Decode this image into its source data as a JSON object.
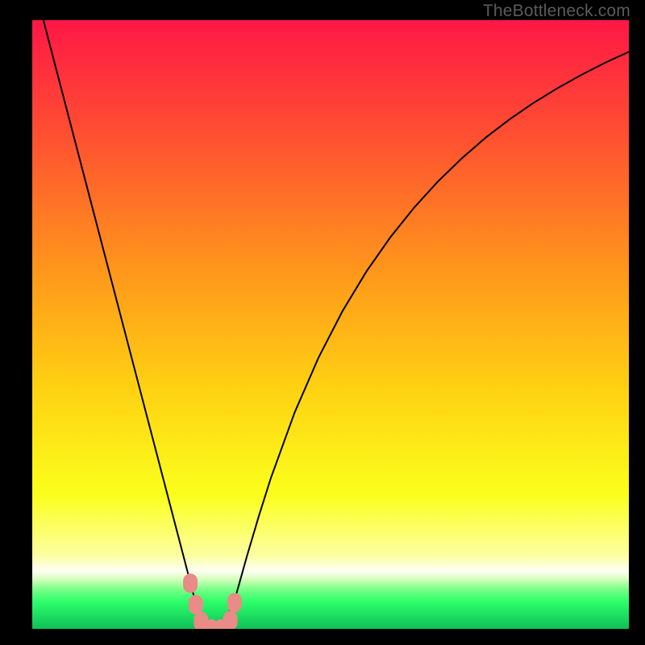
{
  "watermark": "TheBottleneck.com",
  "colors": {
    "bg_black": "#000000",
    "curve": "#000000",
    "marker": "#e98b86",
    "gradient_stops": [
      {
        "offset": 0.0,
        "color": "#ff1746"
      },
      {
        "offset": 0.2,
        "color": "#ff5330"
      },
      {
        "offset": 0.4,
        "color": "#ff931c"
      },
      {
        "offset": 0.6,
        "color": "#ffd012"
      },
      {
        "offset": 0.78,
        "color": "#fbff1c"
      },
      {
        "offset": 0.88,
        "color": "#fcffa2"
      },
      {
        "offset": 0.905,
        "color": "#fdfff5"
      },
      {
        "offset": 0.918,
        "color": "#d7ffbe"
      },
      {
        "offset": 0.935,
        "color": "#79ff88"
      },
      {
        "offset": 0.955,
        "color": "#2dff6a"
      },
      {
        "offset": 1.0,
        "color": "#0fbf58"
      }
    ]
  },
  "chart_data": {
    "type": "line",
    "title": "",
    "xlabel": "",
    "ylabel": "",
    "xlim": [
      0,
      100
    ],
    "ylim": [
      0,
      100
    ],
    "x": [
      0,
      2,
      4,
      6,
      8,
      10,
      12,
      14,
      16,
      18,
      20,
      22,
      24,
      26,
      27,
      28,
      29,
      30,
      31,
      32,
      34,
      36,
      38,
      40,
      44,
      48,
      52,
      56,
      60,
      64,
      68,
      72,
      76,
      80,
      84,
      88,
      92,
      96,
      100
    ],
    "series": [
      {
        "name": "bottleneck-curve",
        "values": [
          107,
          99.5,
          92,
          84.5,
          77,
          69.5,
          62,
          54.5,
          47,
          39.5,
          32,
          24.5,
          17,
          9.5,
          5.75,
          2,
          1,
          0,
          0,
          0.5,
          5,
          12,
          18.6,
          24.8,
          35.6,
          44.6,
          52.2,
          58.7,
          64.3,
          69.2,
          73.5,
          77.3,
          80.7,
          83.7,
          86.4,
          88.8,
          91,
          93,
          94.8
        ]
      }
    ],
    "markers": {
      "name": "optimal-zone",
      "points": [
        {
          "x": 26.5,
          "y": 7.5
        },
        {
          "x": 27.4,
          "y": 4.0
        },
        {
          "x": 28.3,
          "y": 1.2
        },
        {
          "x": 30.0,
          "y": 0.0
        },
        {
          "x": 31.7,
          "y": 0.0
        },
        {
          "x": 33.2,
          "y": 1.4
        },
        {
          "x": 33.9,
          "y": 4.3
        }
      ]
    }
  }
}
